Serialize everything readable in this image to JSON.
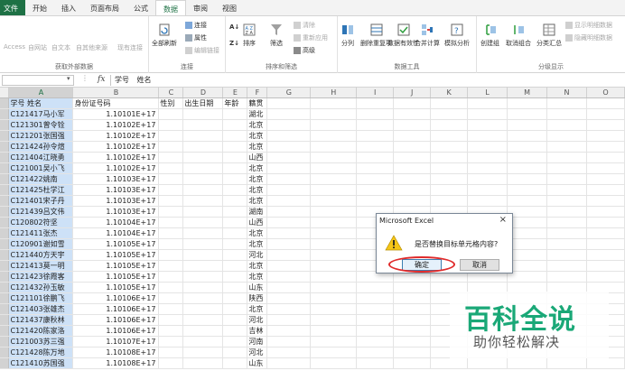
{
  "tabs": [
    "文件",
    "开始",
    "插入",
    "页面布局",
    "公式",
    "数据",
    "审阅",
    "视图"
  ],
  "active_tab": "数据",
  "ribbon": {
    "get_external": {
      "label": "获取外部数据",
      "buttons": [
        "Access",
        "自网站",
        "自文本",
        "自其他来源",
        "现有连接"
      ]
    },
    "connections": {
      "label": "连接",
      "refresh_all": "全部刷新",
      "items": [
        "连接",
        "属性",
        "编辑链接"
      ]
    },
    "sort_filter": {
      "label": "排序和筛选",
      "sort": "排序",
      "filter": "筛选",
      "items": [
        "清除",
        "重新应用",
        "高级"
      ]
    },
    "data_tools": {
      "label": "数据工具",
      "buttons": [
        "分列",
        "删除重复项",
        "数据有效性",
        "合并计算",
        "模拟分析"
      ]
    },
    "outline": {
      "label": "分级显示",
      "buttons": [
        "创建组",
        "取消组合",
        "分类汇总"
      ],
      "small": [
        "显示明细数据",
        "隐藏明细数据"
      ]
    }
  },
  "formula_bar": {
    "name_box": "",
    "fx": "fx",
    "content": "学号  姓名"
  },
  "columns": [
    "A",
    "B",
    "C",
    "D",
    "E",
    "F",
    "G",
    "H",
    "I",
    "J",
    "K",
    "L",
    "M",
    "N",
    "O"
  ],
  "header_row": {
    "a": "学号  姓名",
    "b": "身份证号码",
    "c": "性别",
    "d": "出生日期",
    "e": "年龄",
    "f": "籍贯"
  },
  "rows": [
    {
      "a": "C121417马小军",
      "b": "1.10101E+17",
      "f": "湖北"
    },
    {
      "a": "C121301曾令铨",
      "b": "1.10102E+17",
      "f": "北京"
    },
    {
      "a": "C121201张国强",
      "b": "1.10102E+17",
      "f": "北京"
    },
    {
      "a": "C121424孙令煊",
      "b": "1.10102E+17",
      "f": "北京"
    },
    {
      "a": "C121404江晓勇",
      "b": "1.10102E+17",
      "f": "山西"
    },
    {
      "a": "C121001吴小飞",
      "b": "1.10102E+17",
      "f": "北京"
    },
    {
      "a": "C121422姚南",
      "b": "1.10103E+17",
      "f": "北京"
    },
    {
      "a": "C121425杜学江",
      "b": "1.10103E+17",
      "f": "北京"
    },
    {
      "a": "C121401宋子丹",
      "b": "1.10103E+17",
      "f": "北京"
    },
    {
      "a": "C121439吕文伟",
      "b": "1.10103E+17",
      "f": "湖南"
    },
    {
      "a": "C120802符坚",
      "b": "1.10104E+17",
      "f": "山西"
    },
    {
      "a": "C121411张杰",
      "b": "1.10104E+17",
      "f": "北京"
    },
    {
      "a": "C120901谢如雪",
      "b": "1.10105E+17",
      "f": "北京"
    },
    {
      "a": "C121440方天宇",
      "b": "1.10105E+17",
      "f": "河北"
    },
    {
      "a": "C121413莫一明",
      "b": "1.10105E+17",
      "f": "北京"
    },
    {
      "a": "C121423徐霞客",
      "b": "1.10105E+17",
      "f": "北京"
    },
    {
      "a": "C121432孙玉敏",
      "b": "1.10105E+17",
      "f": "山东"
    },
    {
      "a": "C121101徐鹏飞",
      "b": "1.10106E+17",
      "f": "陕西"
    },
    {
      "a": "C121403张雄杰",
      "b": "1.10106E+17",
      "f": "北京"
    },
    {
      "a": "C121437康秋林",
      "b": "1.10106E+17",
      "f": "河北"
    },
    {
      "a": "C121420陈家洛",
      "b": "1.10106E+17",
      "f": "吉林"
    },
    {
      "a": "C121003苏三强",
      "b": "1.10107E+17",
      "f": "河南"
    },
    {
      "a": "C121428陈万地",
      "b": "1.10108E+17",
      "f": "河北"
    },
    {
      "a": "C121410苏国强",
      "b": "1.10108E+17",
      "f": "山东"
    }
  ],
  "dialog": {
    "title": "Microsoft Excel",
    "close": "×",
    "message": "是否替换目标单元格内容?",
    "ok": "确定",
    "cancel": "取消"
  },
  "watermark": {
    "line1": "百科全说",
    "line2": "助你轻松解决"
  },
  "colors": {
    "excel_green": "#1e7145",
    "selection_fill": "#cde1f7",
    "highlight_circle": "#e02b2b",
    "watermark_green": "#1aa877"
  }
}
